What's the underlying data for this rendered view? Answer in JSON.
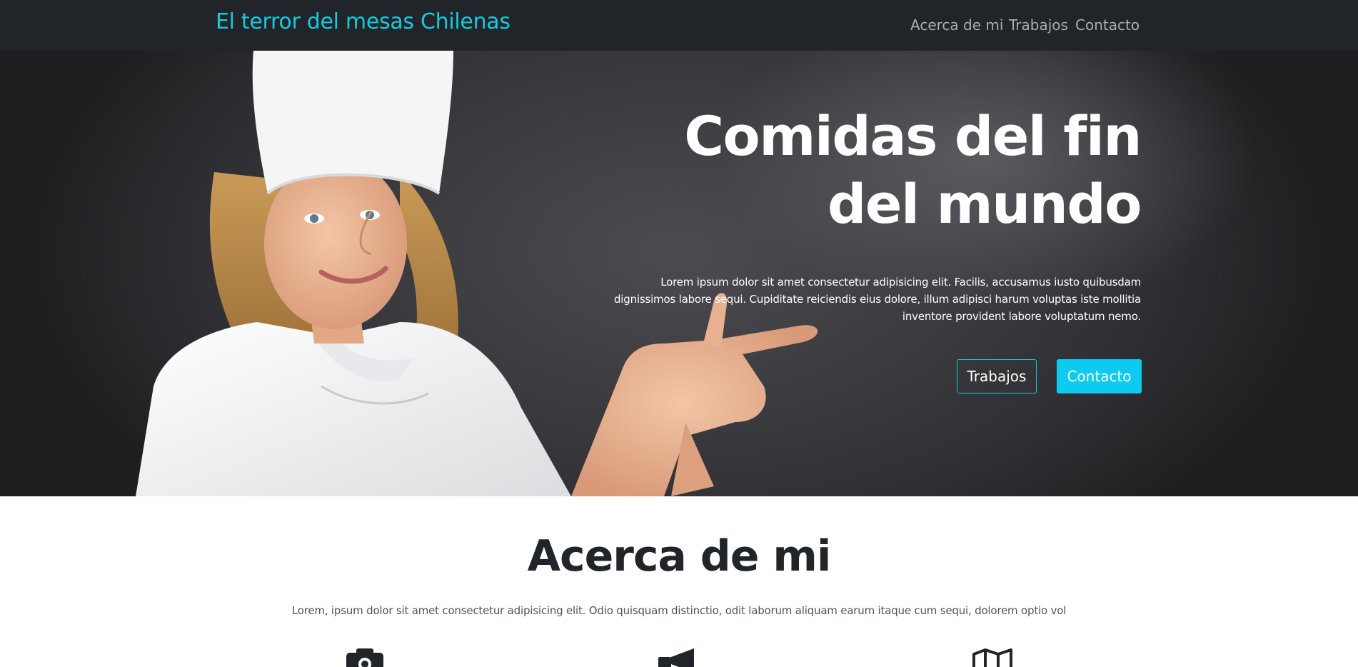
{
  "navbar": {
    "brand": "El terror del mesas Chilenas",
    "links": [
      "Acerca de mi",
      "Trabajos",
      "Contacto"
    ]
  },
  "hero": {
    "title_line1": "Comidas del fin",
    "title_line2": "del mundo",
    "text": "Lorem ipsum dolor sit amet consectetur adipisicing elit. Facilis, accusamus iusto quibusdam dignissimos labore sequi. Cupiditate reiciendis eius dolore, illum adipisci harum voluptas iste mollitia inventore provident labore voluptatum nemo.",
    "buttons": {
      "secondary": "Trabajos",
      "primary": "Contacto"
    },
    "image": "chef-woman-pointing"
  },
  "about": {
    "title": "Acerca de mi",
    "text": "Lorem, ipsum dolor sit amet consectetur adipisicing elit. Odio quisquam distinctio, odit laborum aliquam earum itaque cum sequi, dolorem optio vol",
    "features": [
      {
        "icon": "camera-icon"
      },
      {
        "icon": "bullhorn-icon"
      },
      {
        "icon": "map-icon"
      }
    ]
  },
  "colors": {
    "navbar_bg": "#212529",
    "brand": "#17c9dc",
    "primary_button": "#0dcaf0",
    "hero_bg": "#38373c"
  }
}
